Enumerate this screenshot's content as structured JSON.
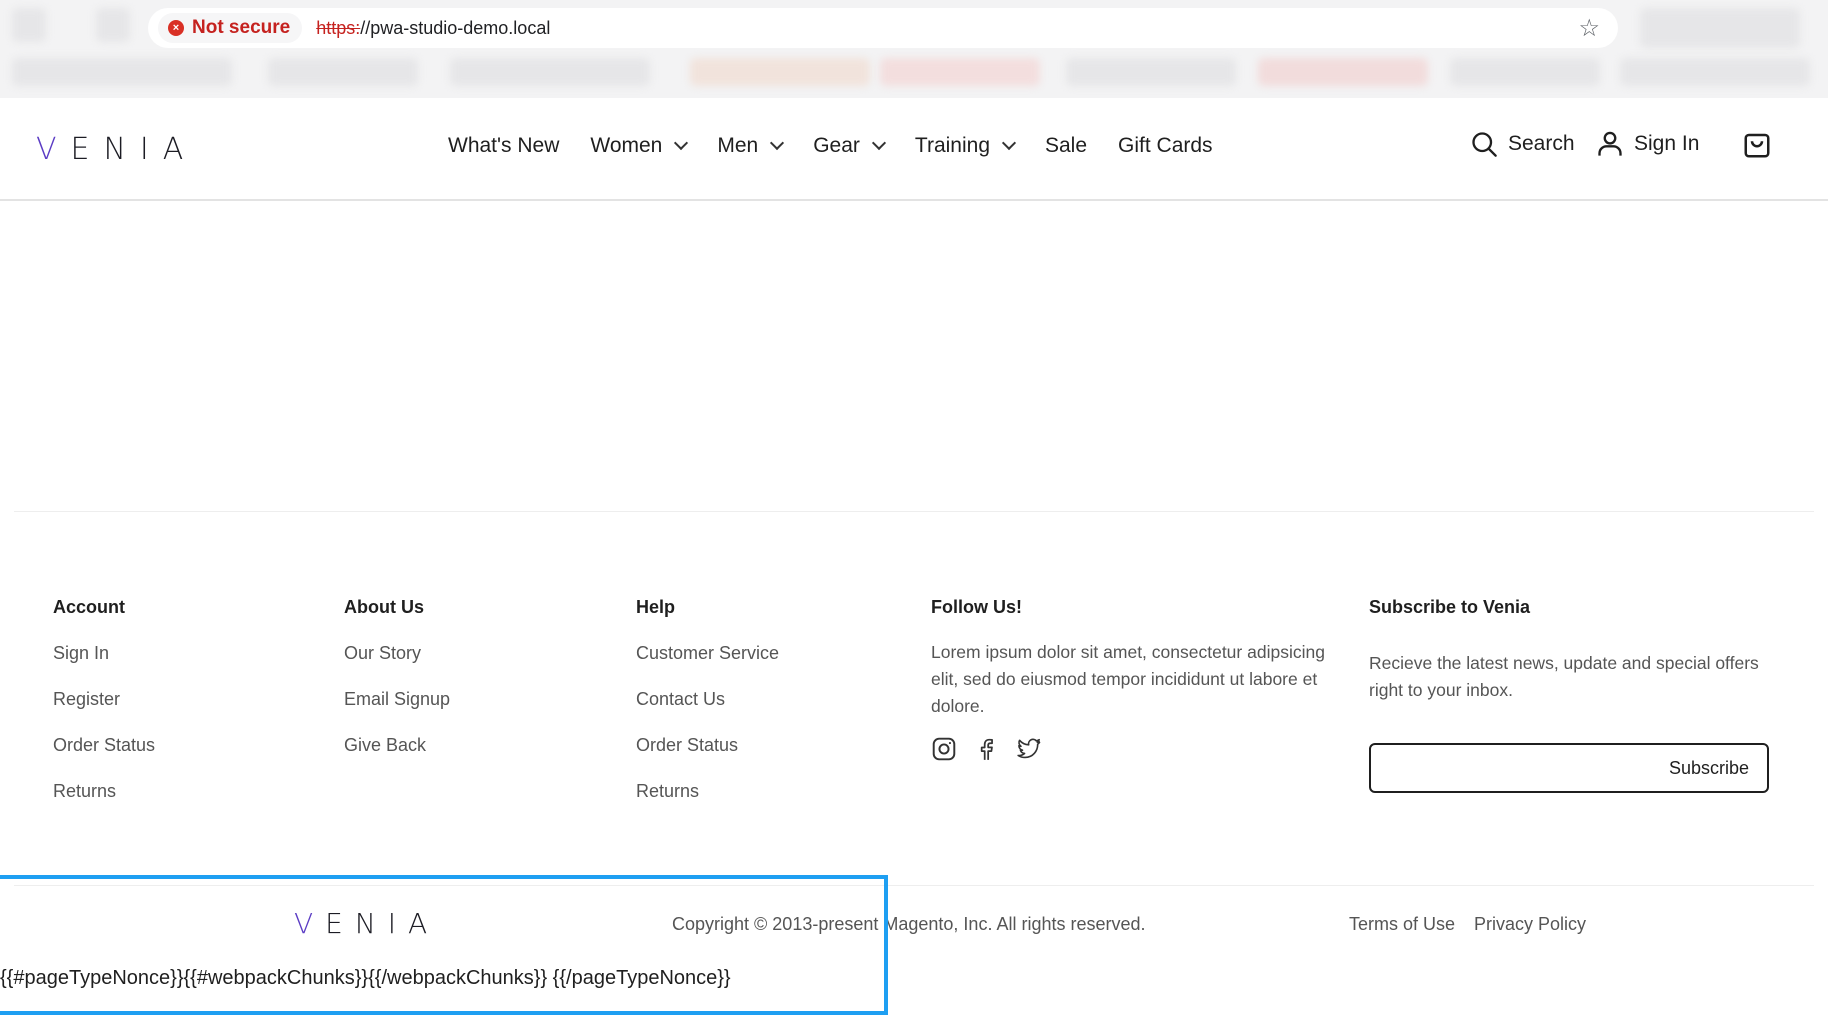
{
  "browser": {
    "security_label": "Not secure",
    "url_scheme": "https:",
    "url_rest": "//pwa-studio-demo.local",
    "bookmark_icon": "star-icon"
  },
  "header": {
    "logo": "VENIA",
    "nav": [
      {
        "label": "What's New",
        "has_dropdown": false
      },
      {
        "label": "Women",
        "has_dropdown": true
      },
      {
        "label": "Men",
        "has_dropdown": true
      },
      {
        "label": "Gear",
        "has_dropdown": true
      },
      {
        "label": "Training",
        "has_dropdown": true
      },
      {
        "label": "Sale",
        "has_dropdown": false
      },
      {
        "label": "Gift Cards",
        "has_dropdown": false
      }
    ],
    "search_label": "Search",
    "signin_label": "Sign In",
    "cart_icon": "shopping-bag-icon"
  },
  "footer": {
    "account": {
      "title": "Account",
      "links": [
        "Sign In",
        "Register",
        "Order Status",
        "Returns"
      ]
    },
    "about": {
      "title": "About Us",
      "links": [
        "Our Story",
        "Email Signup",
        "Give Back"
      ]
    },
    "help": {
      "title": "Help",
      "links": [
        "Customer Service",
        "Contact Us",
        "Order Status",
        "Returns"
      ]
    },
    "follow": {
      "title": "Follow Us!",
      "text": "Lorem ipsum dolor sit amet, consectetur adipsicing elit, sed do eiusmod tempor incididunt ut labore et dolore.",
      "icons": [
        "instagram-icon",
        "facebook-icon",
        "twitter-icon"
      ]
    },
    "subscribe": {
      "title": "Subscribe to Venia",
      "text": "Recieve the latest news, update and special offers right to your inbox.",
      "button": "Subscribe"
    },
    "bottom_logo": "VENIA",
    "copyright": "Copyright © 2013-present Magento, Inc. All rights reserved.",
    "terms": "Terms of Use",
    "privacy": "Privacy Policy",
    "template_text": "{{#pageTypeNonce}}{{#webpackChunks}}{{/webpackChunks}} {{/pageTypeNonce}}"
  },
  "colors": {
    "accent": "#5b3cc4",
    "highlight": "#1e9ff2",
    "warning": "#c5221f"
  }
}
